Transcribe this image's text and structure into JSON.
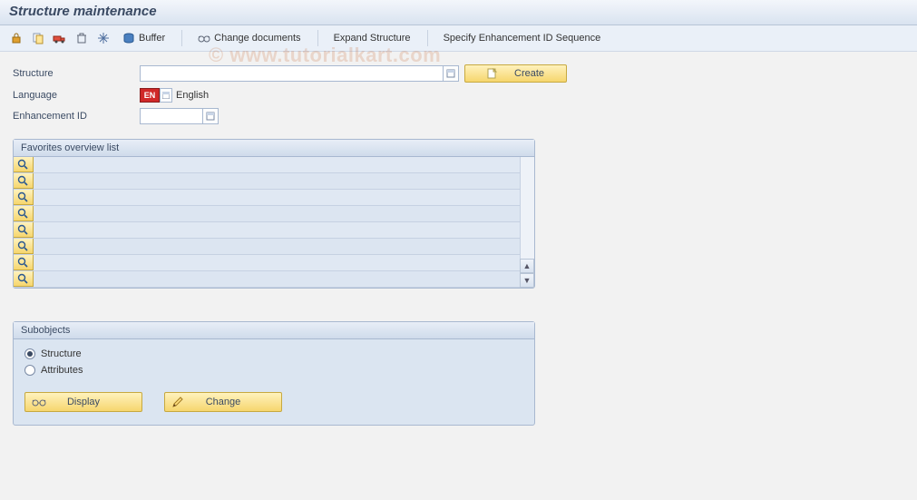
{
  "title": "Structure maintenance",
  "watermark": "© www.tutorialkart.com",
  "toolbar": {
    "buffer_label": "Buffer",
    "change_docs_label": "Change documents",
    "expand_label": "Expand Structure",
    "specify_label": "Specify Enhancement ID Sequence"
  },
  "form": {
    "structure_label": "Structure",
    "structure_value": "",
    "language_label": "Language",
    "language_code": "EN",
    "language_text": "English",
    "enh_label": "Enhancement ID",
    "enh_value": ""
  },
  "create_button": "Create",
  "favorites": {
    "title": "Favorites overview list",
    "rows": [
      "",
      "",
      "",
      "",
      "",
      "",
      "",
      ""
    ]
  },
  "subobjects": {
    "title": "Subobjects",
    "opt_structure": "Structure",
    "opt_attributes": "Attributes",
    "selected": "structure",
    "display_label": "Display",
    "change_label": "Change"
  }
}
